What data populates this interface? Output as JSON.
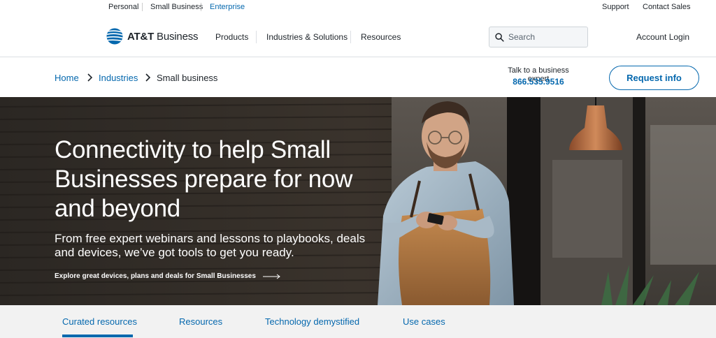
{
  "utility": {
    "personal": "Personal",
    "small_business": "Small Business",
    "enterprise": "Enterprise",
    "support": "Support",
    "contact_sales": "Contact Sales"
  },
  "nav": {
    "logo_brand": "AT&T",
    "logo_suffix": " Business",
    "products": "Products",
    "industries": "Industries & Solutions",
    "resources": "Resources",
    "search_placeholder": "Search",
    "account_login": "Account Login"
  },
  "breadcrumb": {
    "home": "Home",
    "industries": "Industries",
    "current": "Small business"
  },
  "contact": {
    "label": "Talk to a business expert",
    "phone": "866.535.9516",
    "request_button": "Request info"
  },
  "hero": {
    "headline": "Connectivity to help Small Businesses prepare for now and beyond",
    "subtext": "From free expert webinars and lessons to playbooks, deals and devices, we’ve got tools to get you ready.",
    "cta": "Explore great devices, plans and deals for Small Businesses"
  },
  "tabs": [
    {
      "label": "Curated resources",
      "active": true
    },
    {
      "label": "Resources",
      "active": false
    },
    {
      "label": "Technology demystified",
      "active": false
    },
    {
      "label": "Use cases",
      "active": false
    }
  ],
  "colors": {
    "brand_blue": "#0568ae",
    "text_dark": "#1d2329",
    "tab_bar_bg": "#f2f2f2"
  }
}
